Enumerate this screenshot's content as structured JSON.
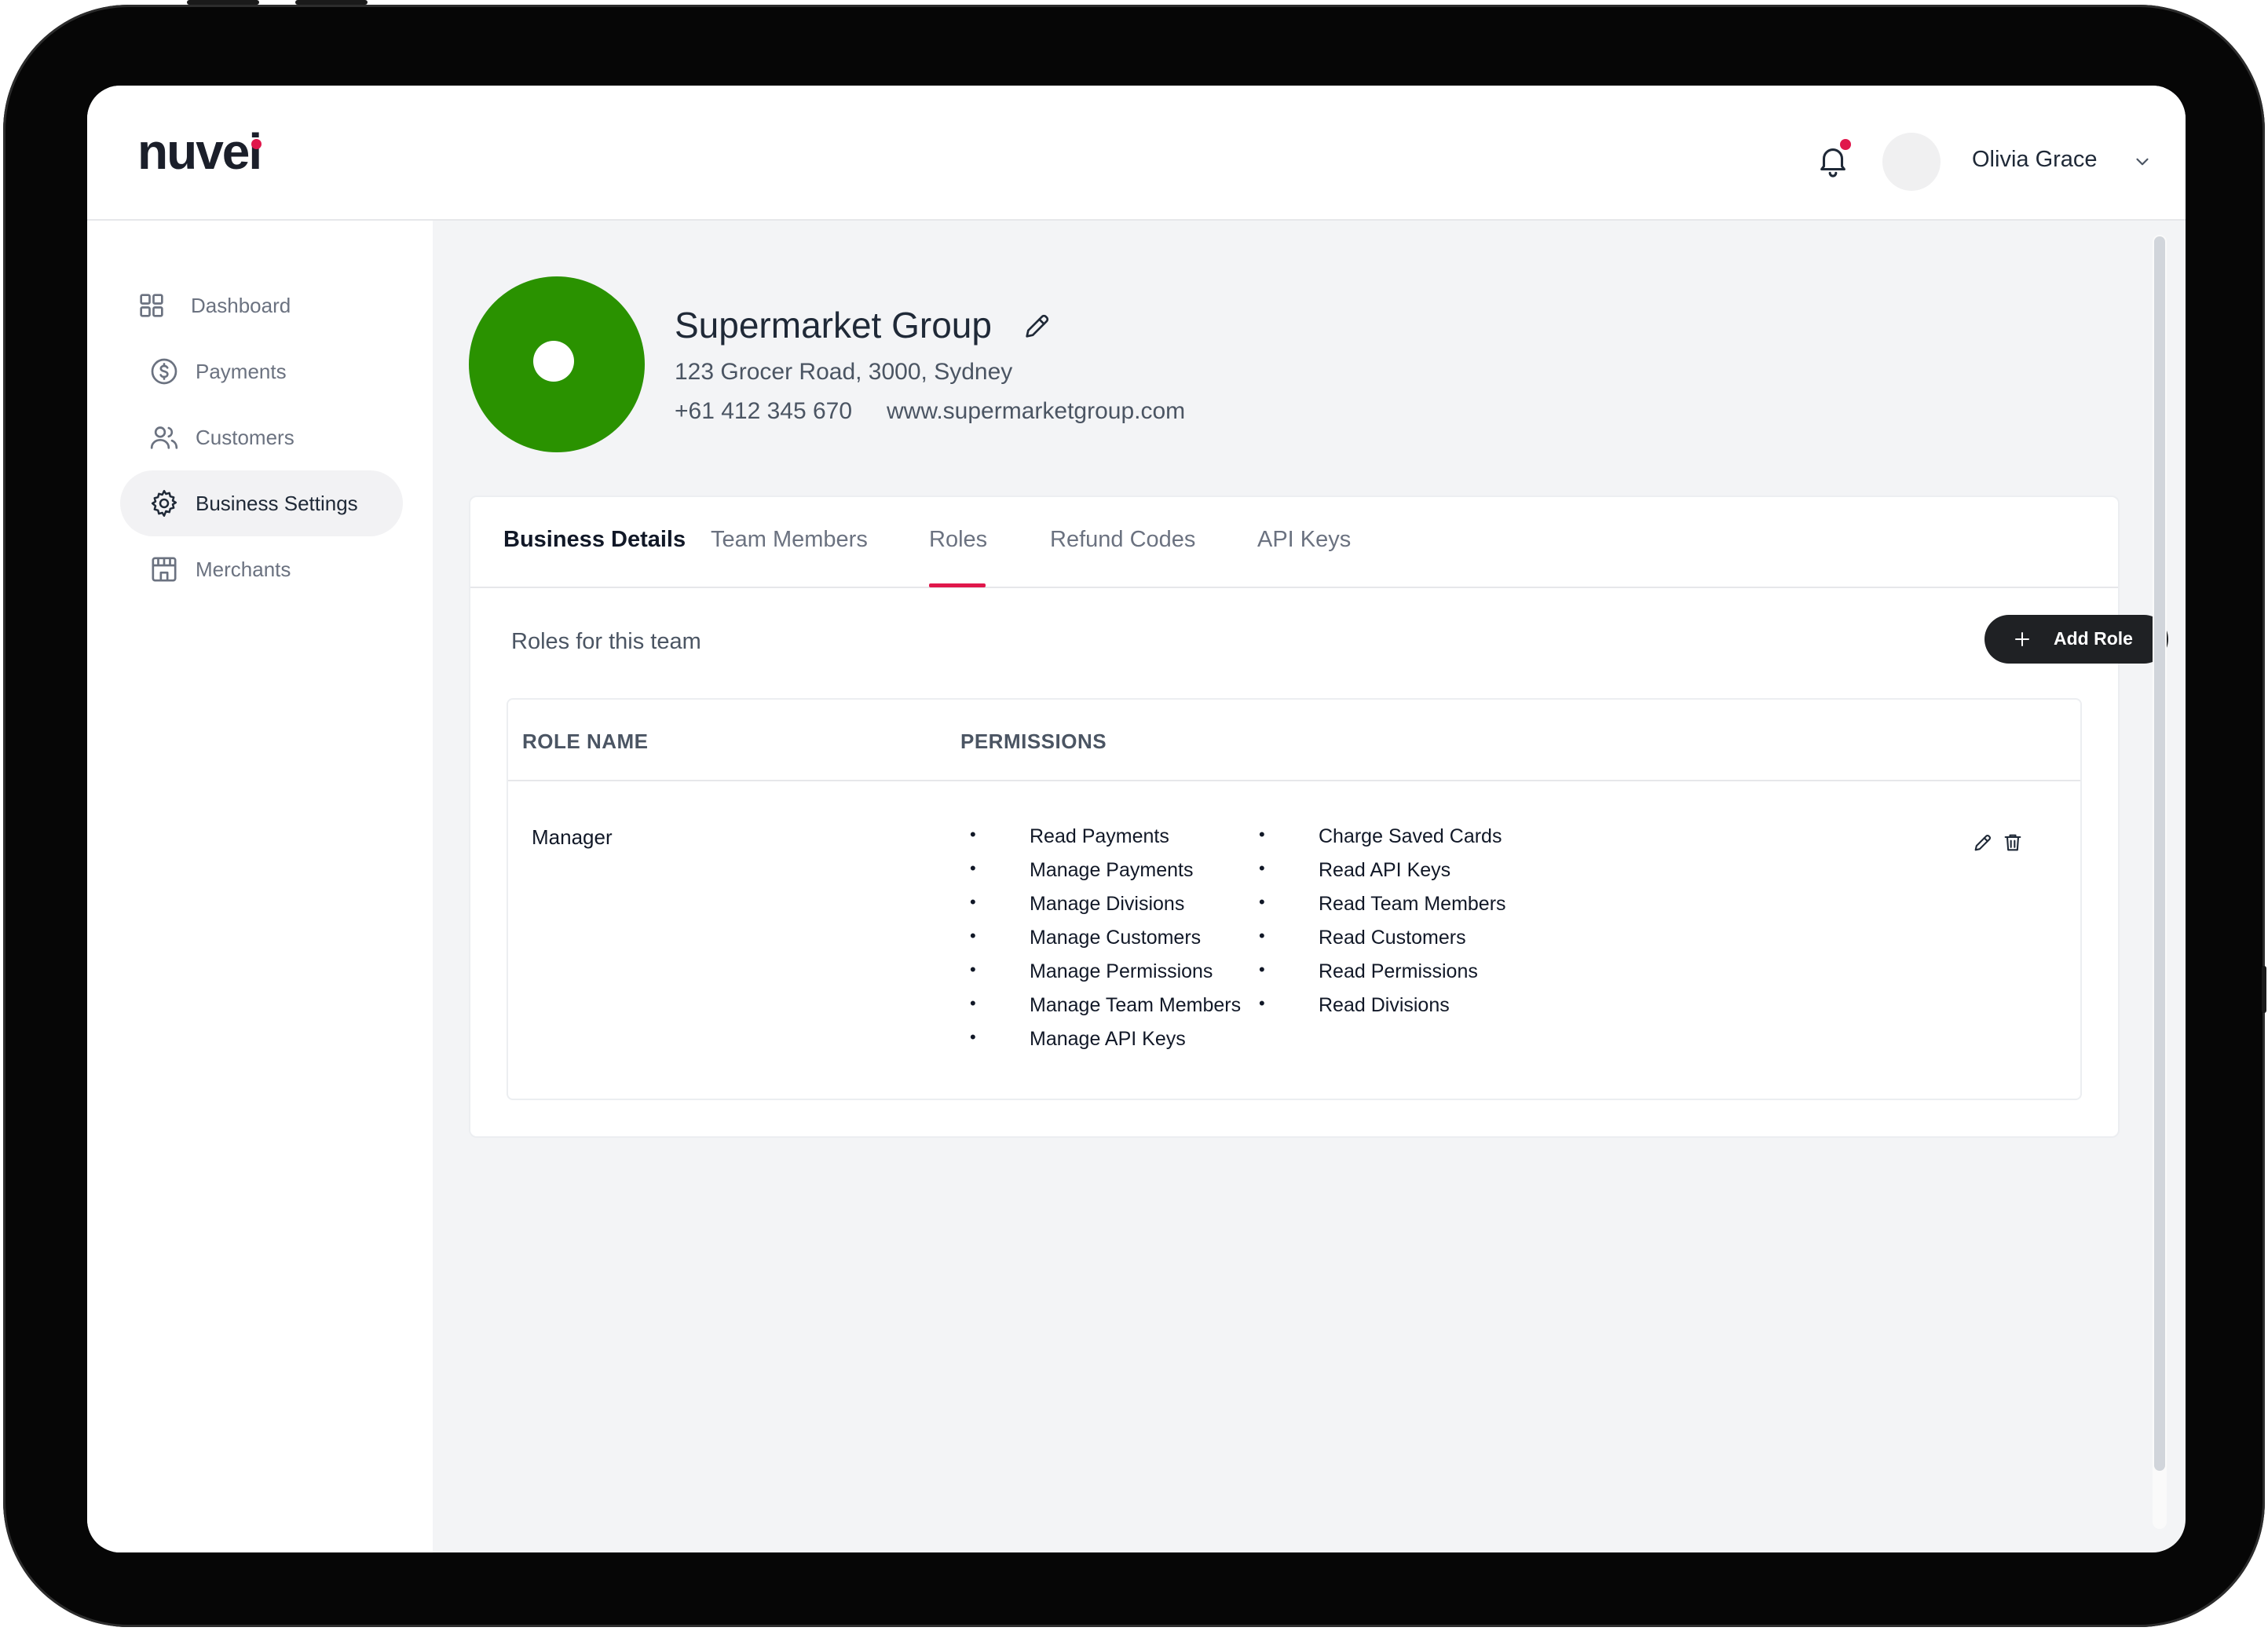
{
  "brand": {
    "logo_text": "nuvei",
    "accent": "#e0174b"
  },
  "header": {
    "user_name": "Olivia Grace",
    "notification_icon": "bell-icon",
    "has_unread_notifications": true
  },
  "sidebar": {
    "items": [
      {
        "label": "Dashboard",
        "icon": "grid-icon",
        "active": false
      },
      {
        "label": "Payments",
        "icon": "dollar-circle-icon",
        "active": false
      },
      {
        "label": "Customers",
        "icon": "users-icon",
        "active": false
      },
      {
        "label": "Business Settings",
        "icon": "gear-icon",
        "active": true
      },
      {
        "label": "Merchants",
        "icon": "store-icon",
        "active": false
      }
    ]
  },
  "business": {
    "name": "Supermarket Group",
    "address": "123 Grocer Road, 3000, Sydney",
    "phone": "+61 412 345 670",
    "website": "www.supermarketgroup.com",
    "avatar_color": "#2a9200"
  },
  "tabs": {
    "items": [
      "Business Details",
      "Team Members",
      "Roles",
      "Refund Codes",
      "API Keys"
    ],
    "selected": "Roles"
  },
  "roles": {
    "title": "Roles for this team",
    "add_button": "Add Role",
    "columns": [
      "ROLE NAME",
      "PERMISSIONS"
    ],
    "rows": [
      {
        "role": "Manager",
        "permissions_col1": [
          "Read Payments",
          "Manage Payments",
          "Manage Divisions",
          "Manage Customers",
          "Manage Permissions",
          "Manage Team Members",
          "Manage API Keys"
        ],
        "permissions_col2": [
          "Charge Saved Cards",
          "Read API Keys",
          "Read Team Members",
          "Read Customers",
          "Read Permissions",
          "Read Divisions"
        ]
      }
    ]
  }
}
